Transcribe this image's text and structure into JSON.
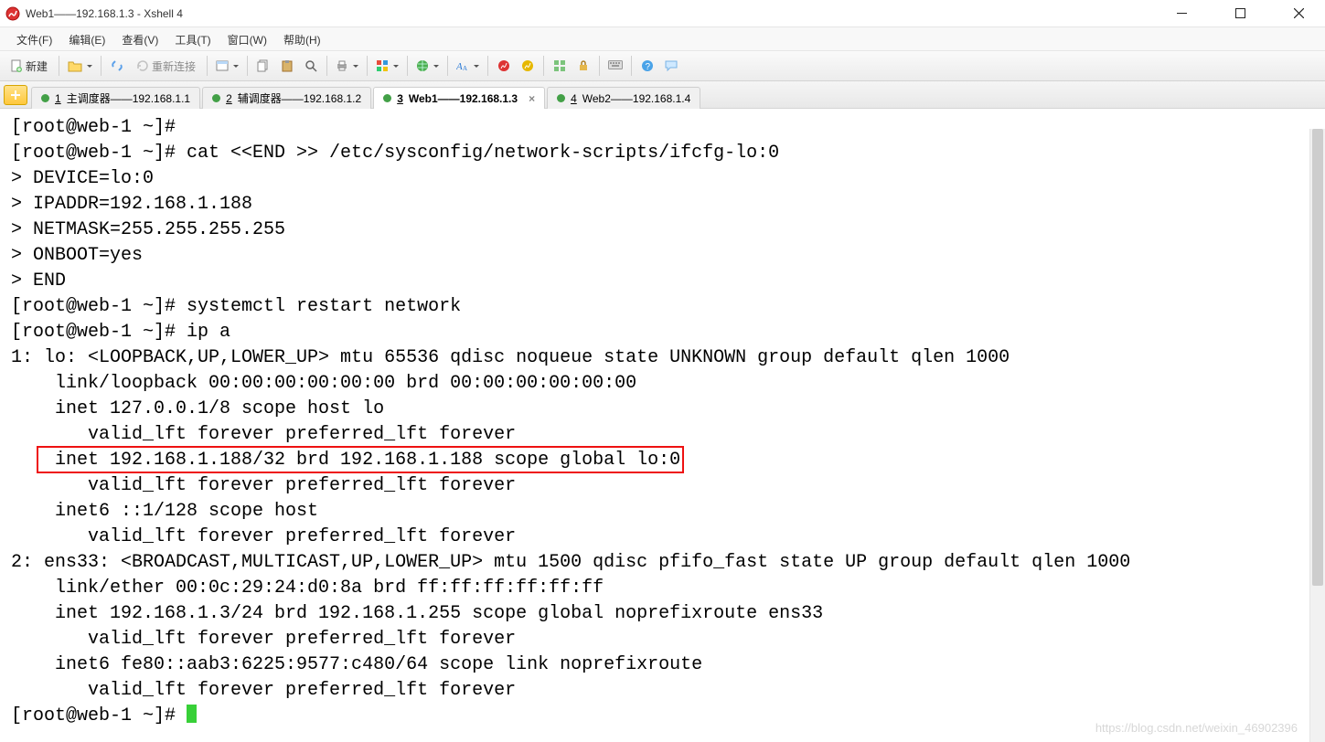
{
  "window": {
    "title": "Web1——192.168.1.3 - Xshell 4"
  },
  "menu": {
    "file": "文件(F)",
    "edit": "编辑(E)",
    "view": "查看(V)",
    "tools": "工具(T)",
    "window": "窗口(W)",
    "help": "帮助(H)"
  },
  "toolbar": {
    "new_label": "新建",
    "reconnect_label": "重新连接"
  },
  "tabs": [
    {
      "num": "1",
      "label": "主调度器——192.168.1.1",
      "active": false,
      "closable": false
    },
    {
      "num": "2",
      "label": "辅调度器——192.168.1.2",
      "active": false,
      "closable": false
    },
    {
      "num": "3",
      "label": "Web1——192.168.1.3",
      "active": true,
      "closable": true
    },
    {
      "num": "4",
      "label": "Web2——192.168.1.4",
      "active": false,
      "closable": false
    }
  ],
  "terminal": {
    "lines": [
      "[root@web-1 ~]#",
      "[root@web-1 ~]# cat <<END >> /etc/sysconfig/network-scripts/ifcfg-lo:0",
      "> DEVICE=lo:0",
      "> IPADDR=192.168.1.188",
      "> NETMASK=255.255.255.255",
      "> ONBOOT=yes",
      "> END",
      "[root@web-1 ~]# systemctl restart network",
      "[root@web-1 ~]# ip a",
      "1: lo: <LOOPBACK,UP,LOWER_UP> mtu 65536 qdisc noqueue state UNKNOWN group default qlen 1000",
      "    link/loopback 00:00:00:00:00:00 brd 00:00:00:00:00:00",
      "    inet 127.0.0.1/8 scope host lo",
      "       valid_lft forever preferred_lft forever",
      "    inet 192.168.1.188/32 brd 192.168.1.188 scope global lo:0",
      "       valid_lft forever preferred_lft forever",
      "    inet6 ::1/128 scope host ",
      "       valid_lft forever preferred_lft forever",
      "2: ens33: <BROADCAST,MULTICAST,UP,LOWER_UP> mtu 1500 qdisc pfifo_fast state UP group default qlen 1000",
      "    link/ether 00:0c:29:24:d0:8a brd ff:ff:ff:ff:ff:ff",
      "    inet 192.168.1.3/24 brd 192.168.1.255 scope global noprefixroute ens33",
      "       valid_lft forever preferred_lft forever",
      "    inet6 fe80::aab3:6225:9577:c480/64 scope link noprefixroute ",
      "       valid_lft forever preferred_lft forever",
      "[root@web-1 ~]# "
    ],
    "highlight_line_index": 13
  },
  "watermark": "https://blog.csdn.net/weixin_46902396"
}
